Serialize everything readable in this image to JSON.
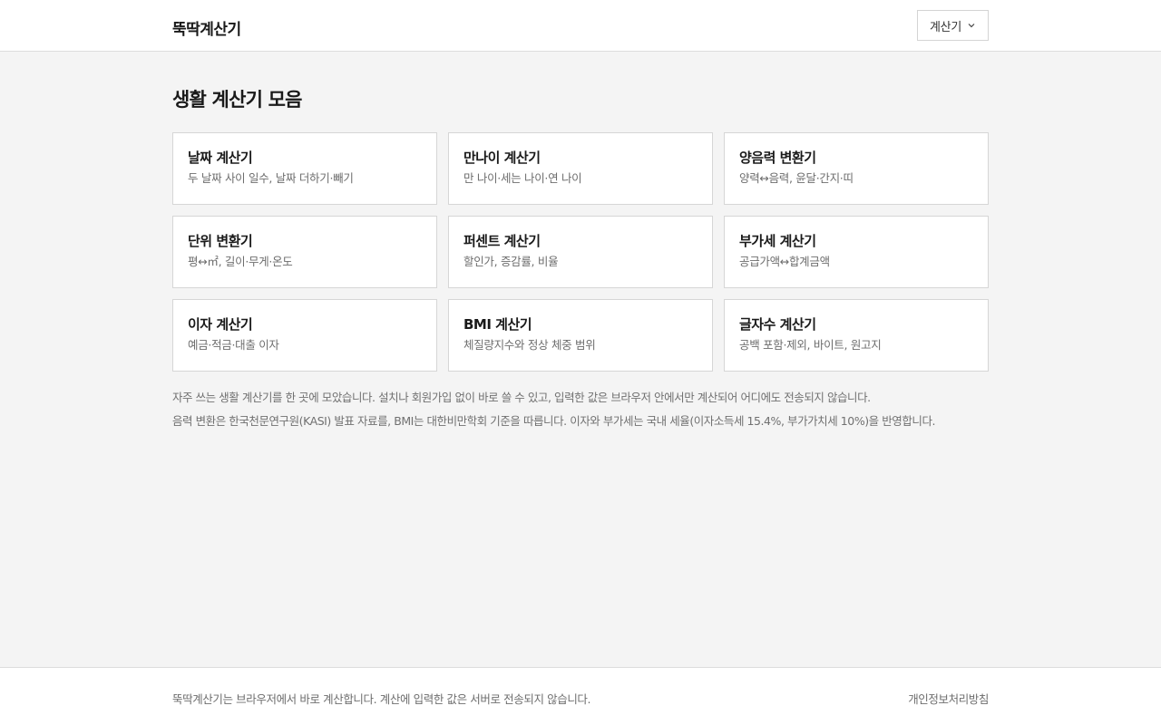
{
  "header": {
    "brand": "뚝딱계산기",
    "menu_label": "계산기",
    "menu_icon": "chevron-down-icon"
  },
  "main": {
    "title": "생활 계산기 모음",
    "cards": [
      {
        "title": "날짜 계산기",
        "desc": "두 날짜 사이 일수, 날짜 더하기·빼기"
      },
      {
        "title": "만나이 계산기",
        "desc": "만 나이·세는 나이·연 나이"
      },
      {
        "title": "양음력 변환기",
        "desc": "양력↔음력, 윤달·간지·띠"
      },
      {
        "title": "단위 변환기",
        "desc": "평↔㎡, 길이·무게·온도"
      },
      {
        "title": "퍼센트 계산기",
        "desc": "할인가, 증감률, 비율"
      },
      {
        "title": "부가세 계산기",
        "desc": "공급가액↔합계금액"
      },
      {
        "title": "이자 계산기",
        "desc": "예금·적금·대출 이자"
      },
      {
        "title": "BMI 계산기",
        "desc": "체질량지수와 정상 체중 범위"
      },
      {
        "title": "글자수 계산기",
        "desc": "공백 포함·제외, 바이트, 원고지"
      }
    ],
    "notes": [
      "자주 쓰는 생활 계산기를 한 곳에 모았습니다. 설치나 회원가입 없이 바로 쓸 수 있고, 입력한 값은 브라우저 안에서만 계산되어 어디에도 전송되지 않습니다.",
      "음력 변환은 한국천문연구원(KASI) 발표 자료를, BMI는 대한비만학회 기준을 따릅니다. 이자와 부가세는 국내 세율(이자소득세 15.4%, 부가가치세 10%)을 반영합니다."
    ]
  },
  "footer": {
    "text": "뚝딱계산기는 브라우저에서 바로 계산합니다. 계산에 입력한 값은 서버로 전송되지 않습니다.",
    "privacy_link": "개인정보처리방침"
  }
}
